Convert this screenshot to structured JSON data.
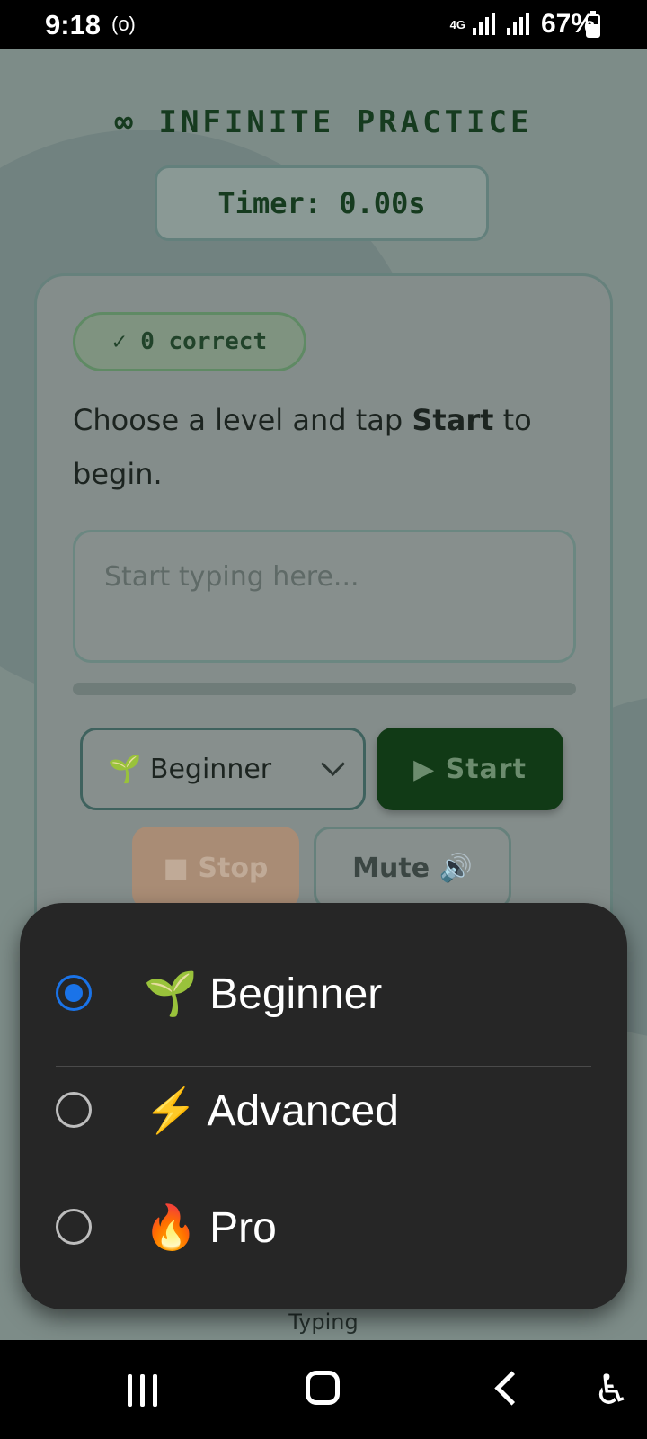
{
  "status_bar": {
    "time": "9:18",
    "radio_icon": "(o)",
    "network": "4G",
    "battery": "67%"
  },
  "app": {
    "title": "∞ INFINITE PRACTICE",
    "timer": "Timer: 0.00s",
    "correct_badge": "✓ 0 correct",
    "prompt_pre": "Choose a level and tap ",
    "prompt_bold": "Start",
    "prompt_post": " to begin.",
    "typing_placeholder": "Start typing here...",
    "progress": 0,
    "level_selected": "🌱 Beginner",
    "start_label": "▶ Start",
    "stop_label": "■ Stop",
    "mute_label": "Mute 🔊",
    "footer": "Typing"
  },
  "level_sheet": {
    "options": [
      {
        "label": "🌱 Beginner",
        "selected": true
      },
      {
        "label": "⚡ Advanced",
        "selected": false
      },
      {
        "label": "🔥 Pro",
        "selected": false
      }
    ],
    "accent_color": "#1a73e8"
  },
  "nav_bar": {
    "accessibility_icon": "♿"
  }
}
